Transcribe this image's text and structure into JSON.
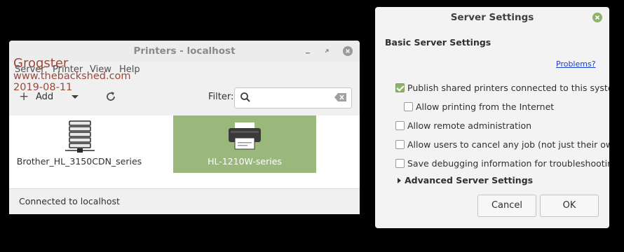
{
  "printers_window": {
    "title": "Printers - localhost",
    "menu": [
      "Server",
      "Printer",
      "View",
      "Help"
    ],
    "toolbar": {
      "add_label": "Add",
      "filter_label": "Filter:",
      "filter_value": ""
    },
    "printers": [
      {
        "name": "Brother_HL_3150CDN_series",
        "selected": false
      },
      {
        "name": "HL-1210W-series",
        "selected": true
      }
    ],
    "status": "Connected to localhost"
  },
  "watermark": {
    "line1": "Grogster",
    "line2": "www.thebackshed.com",
    "line3": "2019-08-11"
  },
  "server_settings": {
    "title": "Server Settings",
    "heading": "Basic Server Settings",
    "problems_link": "Problems?",
    "options": [
      {
        "label": "Publish shared printers connected to this system",
        "checked": true
      },
      {
        "label": "Allow printing from the Internet",
        "checked": false
      },
      {
        "label": "Allow remote administration",
        "checked": false
      },
      {
        "label": "Allow users to cancel any job (not just their own)",
        "checked": false
      },
      {
        "label": "Save debugging information for troubleshooting",
        "checked": false
      }
    ],
    "advanced_label": "Advanced Server Settings",
    "cancel_label": "Cancel",
    "ok_label": "OK"
  },
  "colors": {
    "selection_green": "#9ab87c",
    "checkbox_green": "#8fb26b",
    "link_blue": "#1a3fc9",
    "close_button_green": "#8fb26b",
    "watermark_red": "#9a4a3c"
  }
}
